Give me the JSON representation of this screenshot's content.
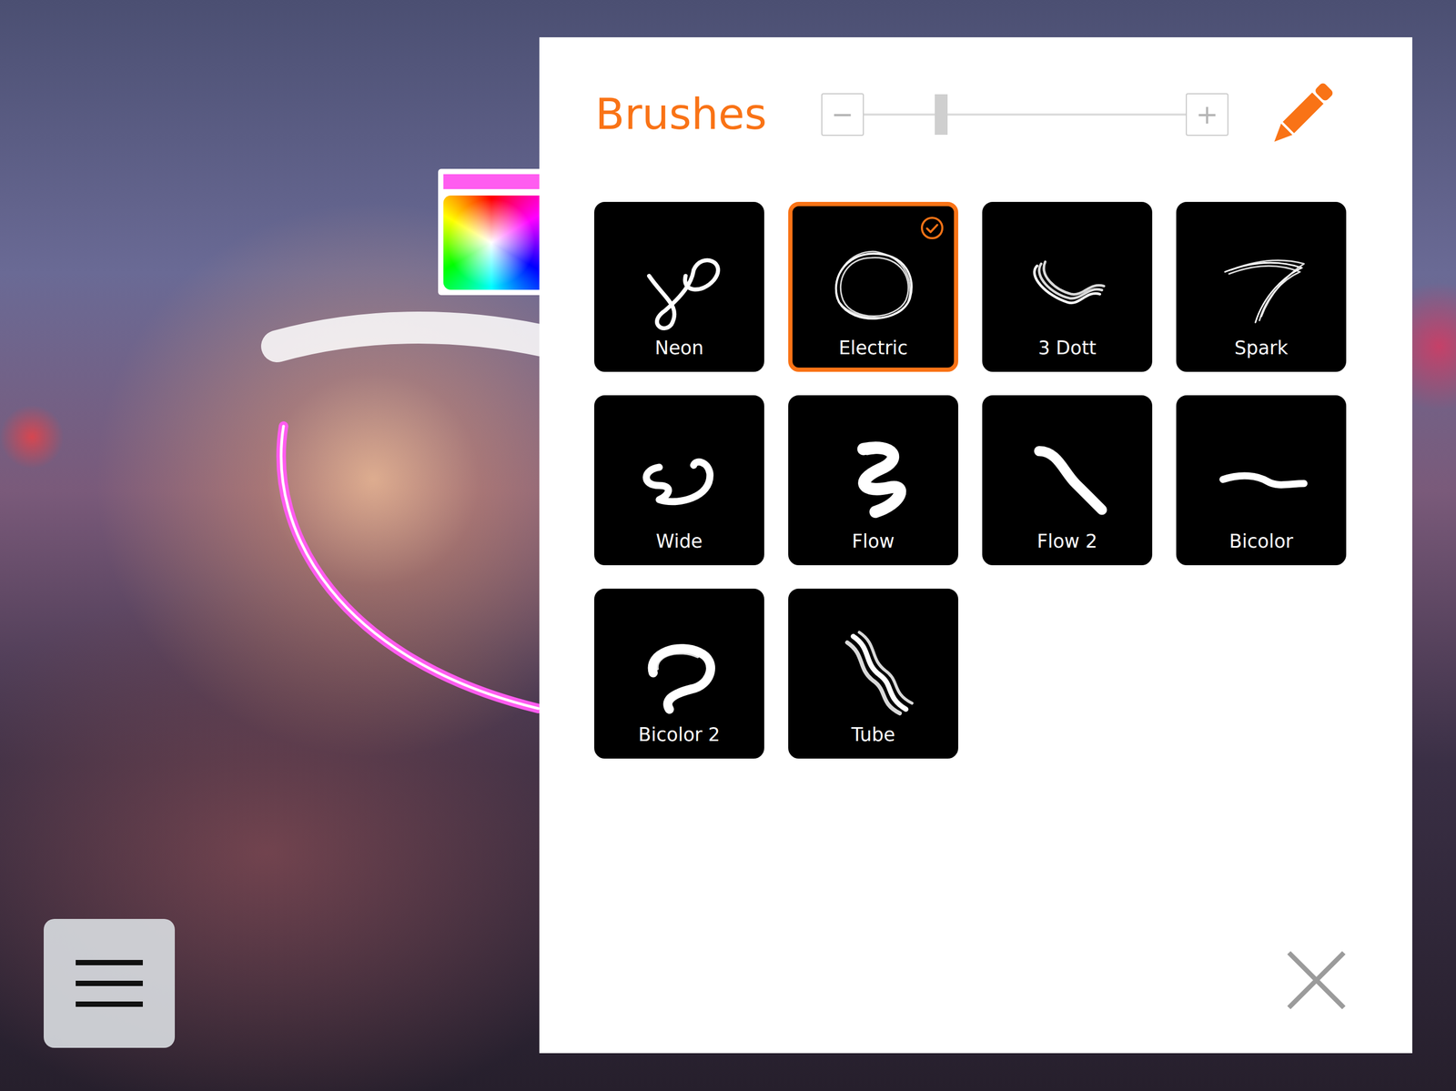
{
  "panel": {
    "title": "Brushes"
  },
  "size_slider": {
    "minus": "−",
    "plus": "+",
    "level": 0.24
  },
  "color_picker": {
    "color": "#ff5cf0"
  },
  "brushes": [
    {
      "name": "Neon",
      "selected": false
    },
    {
      "name": "Electric",
      "selected": true
    },
    {
      "name": "3 Dott",
      "selected": false
    },
    {
      "name": "Spark",
      "selected": false
    },
    {
      "name": "Wide",
      "selected": false
    },
    {
      "name": "Flow",
      "selected": false
    },
    {
      "name": "Flow 2",
      "selected": false
    },
    {
      "name": "Bicolor",
      "selected": false
    },
    {
      "name": "Bicolor 2",
      "selected": false
    },
    {
      "name": "Tube",
      "selected": false
    }
  ]
}
